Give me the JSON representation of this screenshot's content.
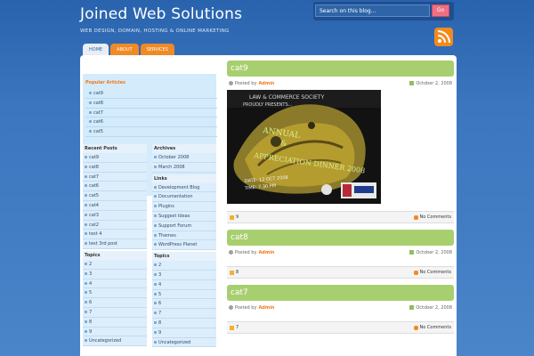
{
  "site": {
    "title": "Joined Web Solutions",
    "tagline": "WEB DESIGN, DOMAIN, HOSTING & ONLINE MARKETING"
  },
  "search": {
    "placeholder": "Search on this blog...",
    "go_label": "Go"
  },
  "tabs": [
    {
      "label": "HOME",
      "active": true
    },
    {
      "label": "ABOUT",
      "active": false
    },
    {
      "label": "SERVICES",
      "active": false
    }
  ],
  "sidebar": {
    "popular": {
      "title": "Popular Articles",
      "items": [
        "cat9",
        "cat8",
        "cat7",
        "cat6",
        "cat5"
      ]
    },
    "recent": {
      "title": "Recent Posts",
      "items": [
        "cat9",
        "cat8",
        "cat7",
        "cat6",
        "cat5",
        "cat4",
        "cat3",
        "cat2",
        "test 4",
        "test 3rd post"
      ]
    },
    "topics_left": {
      "title": "Topics",
      "items": [
        "2",
        "3",
        "4",
        "5",
        "6",
        "7",
        "8",
        "9",
        "Uncategorized"
      ]
    },
    "archives": {
      "title": "Archives",
      "items": [
        "October 2008",
        "March 2008"
      ]
    },
    "links": {
      "title": "Links",
      "items": [
        "Development Blog",
        "Documentation",
        "Plugins",
        "Suggest Ideas",
        "Support Forum",
        "Themes",
        "WordPress Planet"
      ]
    },
    "topics_right": {
      "title": "Topics",
      "items": [
        "2",
        "3",
        "4",
        "5",
        "6",
        "7",
        "8",
        "9",
        "Uncategorized"
      ]
    }
  },
  "posts": [
    {
      "title": "cat9",
      "posted_by": "Posted by",
      "author": "Admin",
      "date": "October 2, 2008",
      "tag": "9",
      "comments": "No Comments",
      "image_text": "ANNUAL APPRECIATION DINNER 2008"
    },
    {
      "title": "cat8",
      "posted_by": "Posted by",
      "author": "Admin",
      "date": "October 2, 2008",
      "tag": "8",
      "comments": "No Comments"
    },
    {
      "title": "cat7",
      "posted_by": "Posted by",
      "author": "Admin",
      "date": "October 2, 2008",
      "tag": "7",
      "comments": "No Comments"
    }
  ],
  "colors": {
    "accent_orange": "#f08a27",
    "post_header_green": "#a8cf6f",
    "background_blue": "#3b76bf"
  }
}
